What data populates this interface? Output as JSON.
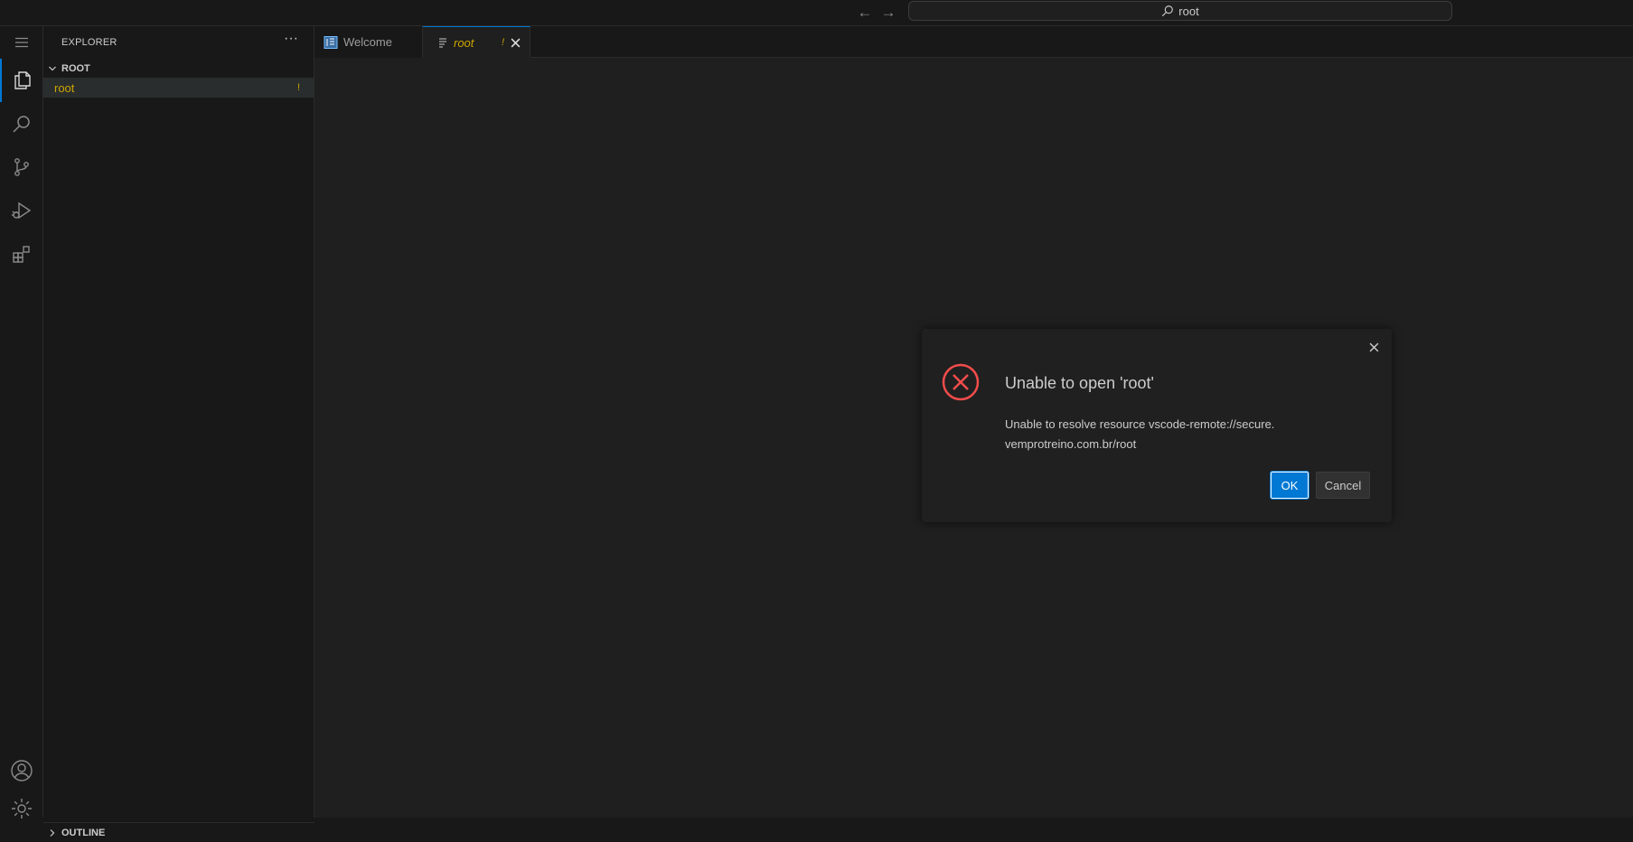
{
  "titlebar": {
    "search_text": "root",
    "back_icon": "arrow-left-icon",
    "forward_icon": "arrow-right-icon"
  },
  "activitybar": {
    "items": [
      "menu-icon",
      "files-icon",
      "search-icon",
      "source-control-icon",
      "run-debug-icon",
      "extensions-icon",
      "account-icon",
      "gear-icon"
    ]
  },
  "sidebar": {
    "title": "EXPLORER",
    "root_section": "ROOT",
    "file_item": "root",
    "file_badge": "!",
    "outline_section": "OUTLINE"
  },
  "tabs": [
    {
      "label": "Welcome",
      "icon": "welcome-icon"
    },
    {
      "label": "root",
      "icon": "file-icon",
      "badge": "!"
    }
  ],
  "dialog": {
    "title": "Unable to open 'root'",
    "message": "Unable to resolve resource vscode-remote://secure.vemprotreino.com.br/root",
    "ok_label": "OK",
    "cancel_label": "Cancel"
  },
  "colors": {
    "accent": "#0078d4",
    "warning": "#cca700",
    "error": "#f14c4c"
  }
}
